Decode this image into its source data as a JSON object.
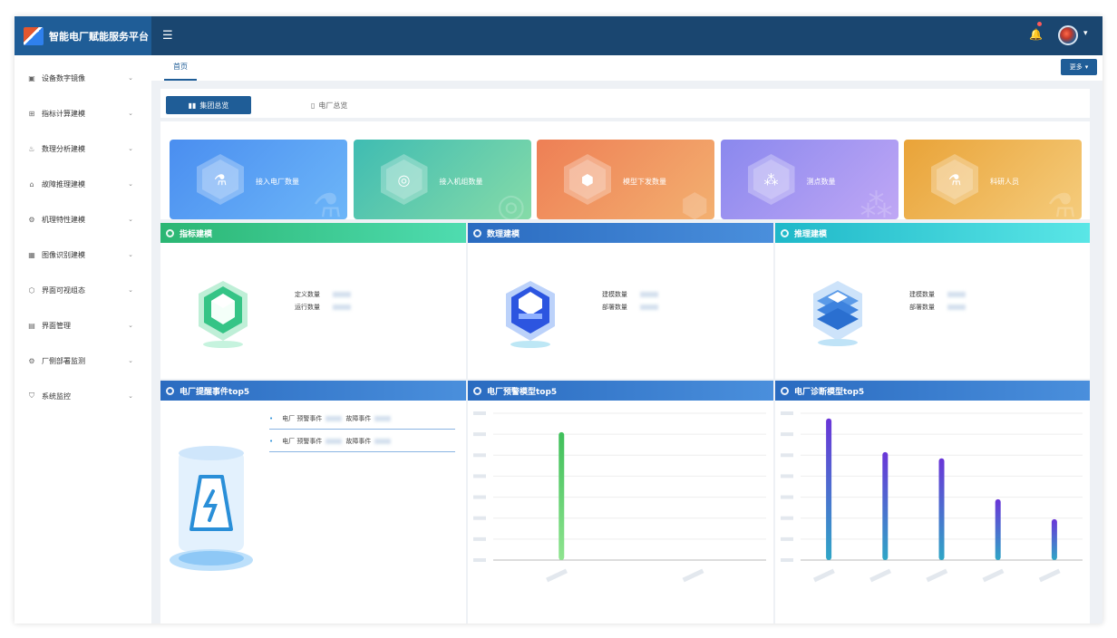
{
  "app": {
    "title": "智能电厂赋能服务平台"
  },
  "header": {
    "collapse_icon": "menu-collapse-icon",
    "bell_icon": "bell-icon",
    "avatar_caret": "⌵"
  },
  "sidebar": {
    "items": [
      {
        "label": "设备数字镜像",
        "icon": "monitor-icon"
      },
      {
        "label": "指标计算建模",
        "icon": "calculator-icon"
      },
      {
        "label": "数理分析建模",
        "icon": "analysis-icon"
      },
      {
        "label": "故障推理建模",
        "icon": "fault-icon"
      },
      {
        "label": "机理特性建模",
        "icon": "mechanism-icon"
      },
      {
        "label": "图像识别建模",
        "icon": "image-icon"
      },
      {
        "label": "界面可视组态",
        "icon": "shield-icon"
      },
      {
        "label": "界面管理",
        "icon": "layout-icon"
      },
      {
        "label": "厂侧部署监测",
        "icon": "gear-icon"
      },
      {
        "label": "系统监控",
        "icon": "shield-check-icon"
      }
    ]
  },
  "tabbar": {
    "home": "首页",
    "more": "更多"
  },
  "content_tabs": {
    "group": "集团总览",
    "plant": "电厂总览"
  },
  "stats": [
    {
      "label": "接入电厂数量",
      "icon": "flask-icon"
    },
    {
      "label": "接入机组数量",
      "icon": "radiation-icon"
    },
    {
      "label": "模型下发数量",
      "icon": "cube-icon"
    },
    {
      "label": "测点数量",
      "icon": "nodes-icon"
    },
    {
      "label": "科研人员",
      "icon": "beaker-icon"
    }
  ],
  "panels": {
    "index": {
      "title": "指标建模",
      "k1": "定义数量",
      "k2": "运行数量"
    },
    "data": {
      "title": "数理建模",
      "k1": "建模数量",
      "k2": "部署数量"
    },
    "infer": {
      "title": "推理建模",
      "k1": "建模数量",
      "k2": "部署数量"
    },
    "events": {
      "title": "电厂提醒事件top5",
      "rows": [
        {
          "a": "电厂",
          "b": "预警事件",
          "c": "故障事件"
        },
        {
          "a": "电厂",
          "b": "预警事件",
          "c": "故障事件"
        }
      ]
    },
    "warn": {
      "title": "电厂预警模型top5"
    },
    "diag": {
      "title": "电厂诊断模型top5"
    }
  },
  "colors": {
    "primary": "#1f5d97",
    "header_dark": "#1a4670",
    "green_bar": "#4cc764",
    "purple_bar": "#6a35d8",
    "teal_bar": "#2fa6c6"
  },
  "chart_data": [
    {
      "type": "bar",
      "title": "电厂预警模型top5",
      "categories": [
        "",
        ""
      ],
      "values": [
        610,
        0
      ],
      "ylim": [
        0,
        700
      ],
      "grid": true
    },
    {
      "type": "bar",
      "title": "电厂诊断模型top5",
      "categories": [
        "",
        "",
        "",
        "",
        ""
      ],
      "values": [
        675,
        515,
        485,
        290,
        195
      ],
      "ylim": [
        0,
        700
      ],
      "grid": true
    }
  ]
}
